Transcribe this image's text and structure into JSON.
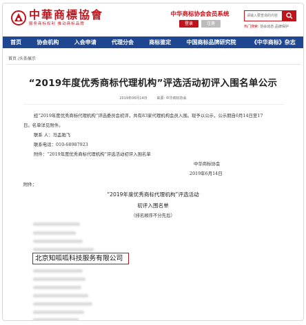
{
  "header": {
    "logo_title": "中華商標協會",
    "logo_subtitle": "服务商标权利 推动商标品牌",
    "member_title": "中华商标协会会员系统",
    "login_label": "登录",
    "register_label": "注册",
    "search_placeholder": "请输入要查询的内容",
    "hot_label": "热门搜索:",
    "hot_terms": "协会动态  品牌保护"
  },
  "nav": {
    "items": [
      "首页",
      "协会机构",
      "入会申请",
      "代理分会",
      "商标鉴定",
      "中国商标品牌研究院",
      "《中华商标》杂志"
    ]
  },
  "breadcrumb": "首页 /头条展示",
  "article": {
    "title": "“2019年度优秀商标代理机构”评选活动初评入围名单公示",
    "date": "2019年06月14日",
    "source": "来源: 中华商标协会",
    "para1_line1": "经“2019年度优秀商标代理机构”评选委员会初评，共有83家代理机构会员入围。现予以公示，公示期自6月14日至17",
    "para1_line2": "日。名单详见附件。",
    "contact_person": "联系 人：马孟驰飞",
    "contact_phone": "联系电话：010-68987923",
    "attachment_note": "附件：“2019年度优秀商标代理机构”评选活动初评入围名单",
    "signature_org": "中华商标协会",
    "signature_date": "2019年6月14日",
    "attachment_label": "附件：",
    "list_title": "“2019年度优秀商标代理机构”评选活动",
    "list_subtitle": "初评入围名单",
    "list_note": "（排名顺序不分先后）",
    "highlighted_company": "北京知呱呱科技服务有限公司"
  },
  "colors": {
    "brand_red": "#c0141c",
    "nav_blue": "#1f4690"
  }
}
